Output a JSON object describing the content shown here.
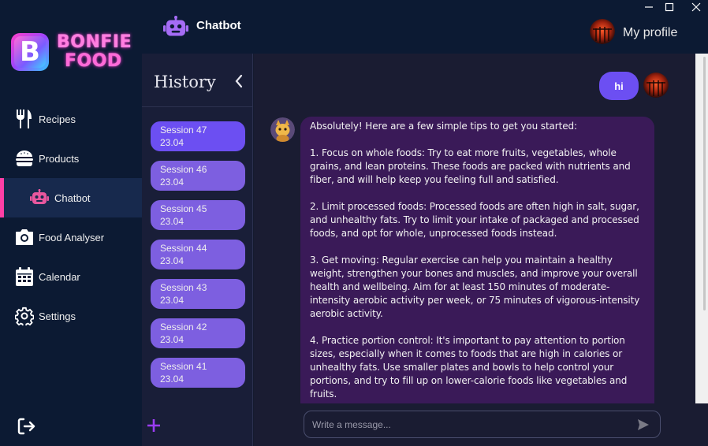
{
  "app": {
    "logo_line1": "BONFIE",
    "logo_line2": "FOOD",
    "logo_letter": "B"
  },
  "sidebar": {
    "items": [
      {
        "label": "Recipes",
        "icon": "fork-knife-icon"
      },
      {
        "label": "Products",
        "icon": "burger-icon"
      },
      {
        "label": "Chatbot",
        "icon": "robot-icon",
        "active": true
      },
      {
        "label": "Food Analyser",
        "icon": "camera-icon"
      },
      {
        "label": "Calendar",
        "icon": "calendar-icon"
      },
      {
        "label": "Settings",
        "icon": "gear-icon"
      }
    ],
    "logout_icon": "logout-icon"
  },
  "header": {
    "title": "Chatbot",
    "profile_label": "My profile"
  },
  "history": {
    "title": "History",
    "sessions": [
      {
        "name": "Session 47",
        "date": "23.04"
      },
      {
        "name": "Session 46",
        "date": "23.04"
      },
      {
        "name": "Session 45",
        "date": "23.04"
      },
      {
        "name": "Session 44",
        "date": "23.04"
      },
      {
        "name": "Session 43",
        "date": "23.04"
      },
      {
        "name": "Session 42",
        "date": "23.04"
      },
      {
        "name": "Session 41",
        "date": "23.04"
      }
    ]
  },
  "chat": {
    "user_message": "hi",
    "bot_paragraphs": [
      "Absolutely! Here are a few simple tips to get you started:",
      "1. Focus on whole foods: Try to eat more fruits, vegetables, whole grains, and lean proteins. These foods are packed with nutrients and fiber, and will help keep you feeling full and satisfied.",
      "2. Limit processed foods: Processed foods are often high in salt, sugar, and unhealthy fats. Try to limit your intake of packaged and processed foods, and opt for whole, unprocessed foods instead.",
      "3. Get moving: Regular exercise can help you maintain a healthy weight, strengthen your bones and muscles, and improve your overall health and wellbeing. Aim for at least 150 minutes of moderate-intensity aerobic activity per week, or 75 minutes of vigorous-intensity aerobic activity.",
      "4. Practice portion control: It's important to pay attention to portion sizes, especially when it comes to foods that are high in calories or unhealthy fats. Use smaller plates and bowls to help control your portions, and try to fill up on lower-calorie foods like vegetables and fruits."
    ],
    "input_placeholder": "Write a message..."
  },
  "colors": {
    "sidebar_bg": "#0c1a33",
    "accent_purple": "#6c4ff2",
    "session_bg": "#7d5fe0",
    "bot_bubble": "#3a1a58",
    "active_marker": "#ff3fa6",
    "robot_icon": "#a56cf5"
  }
}
